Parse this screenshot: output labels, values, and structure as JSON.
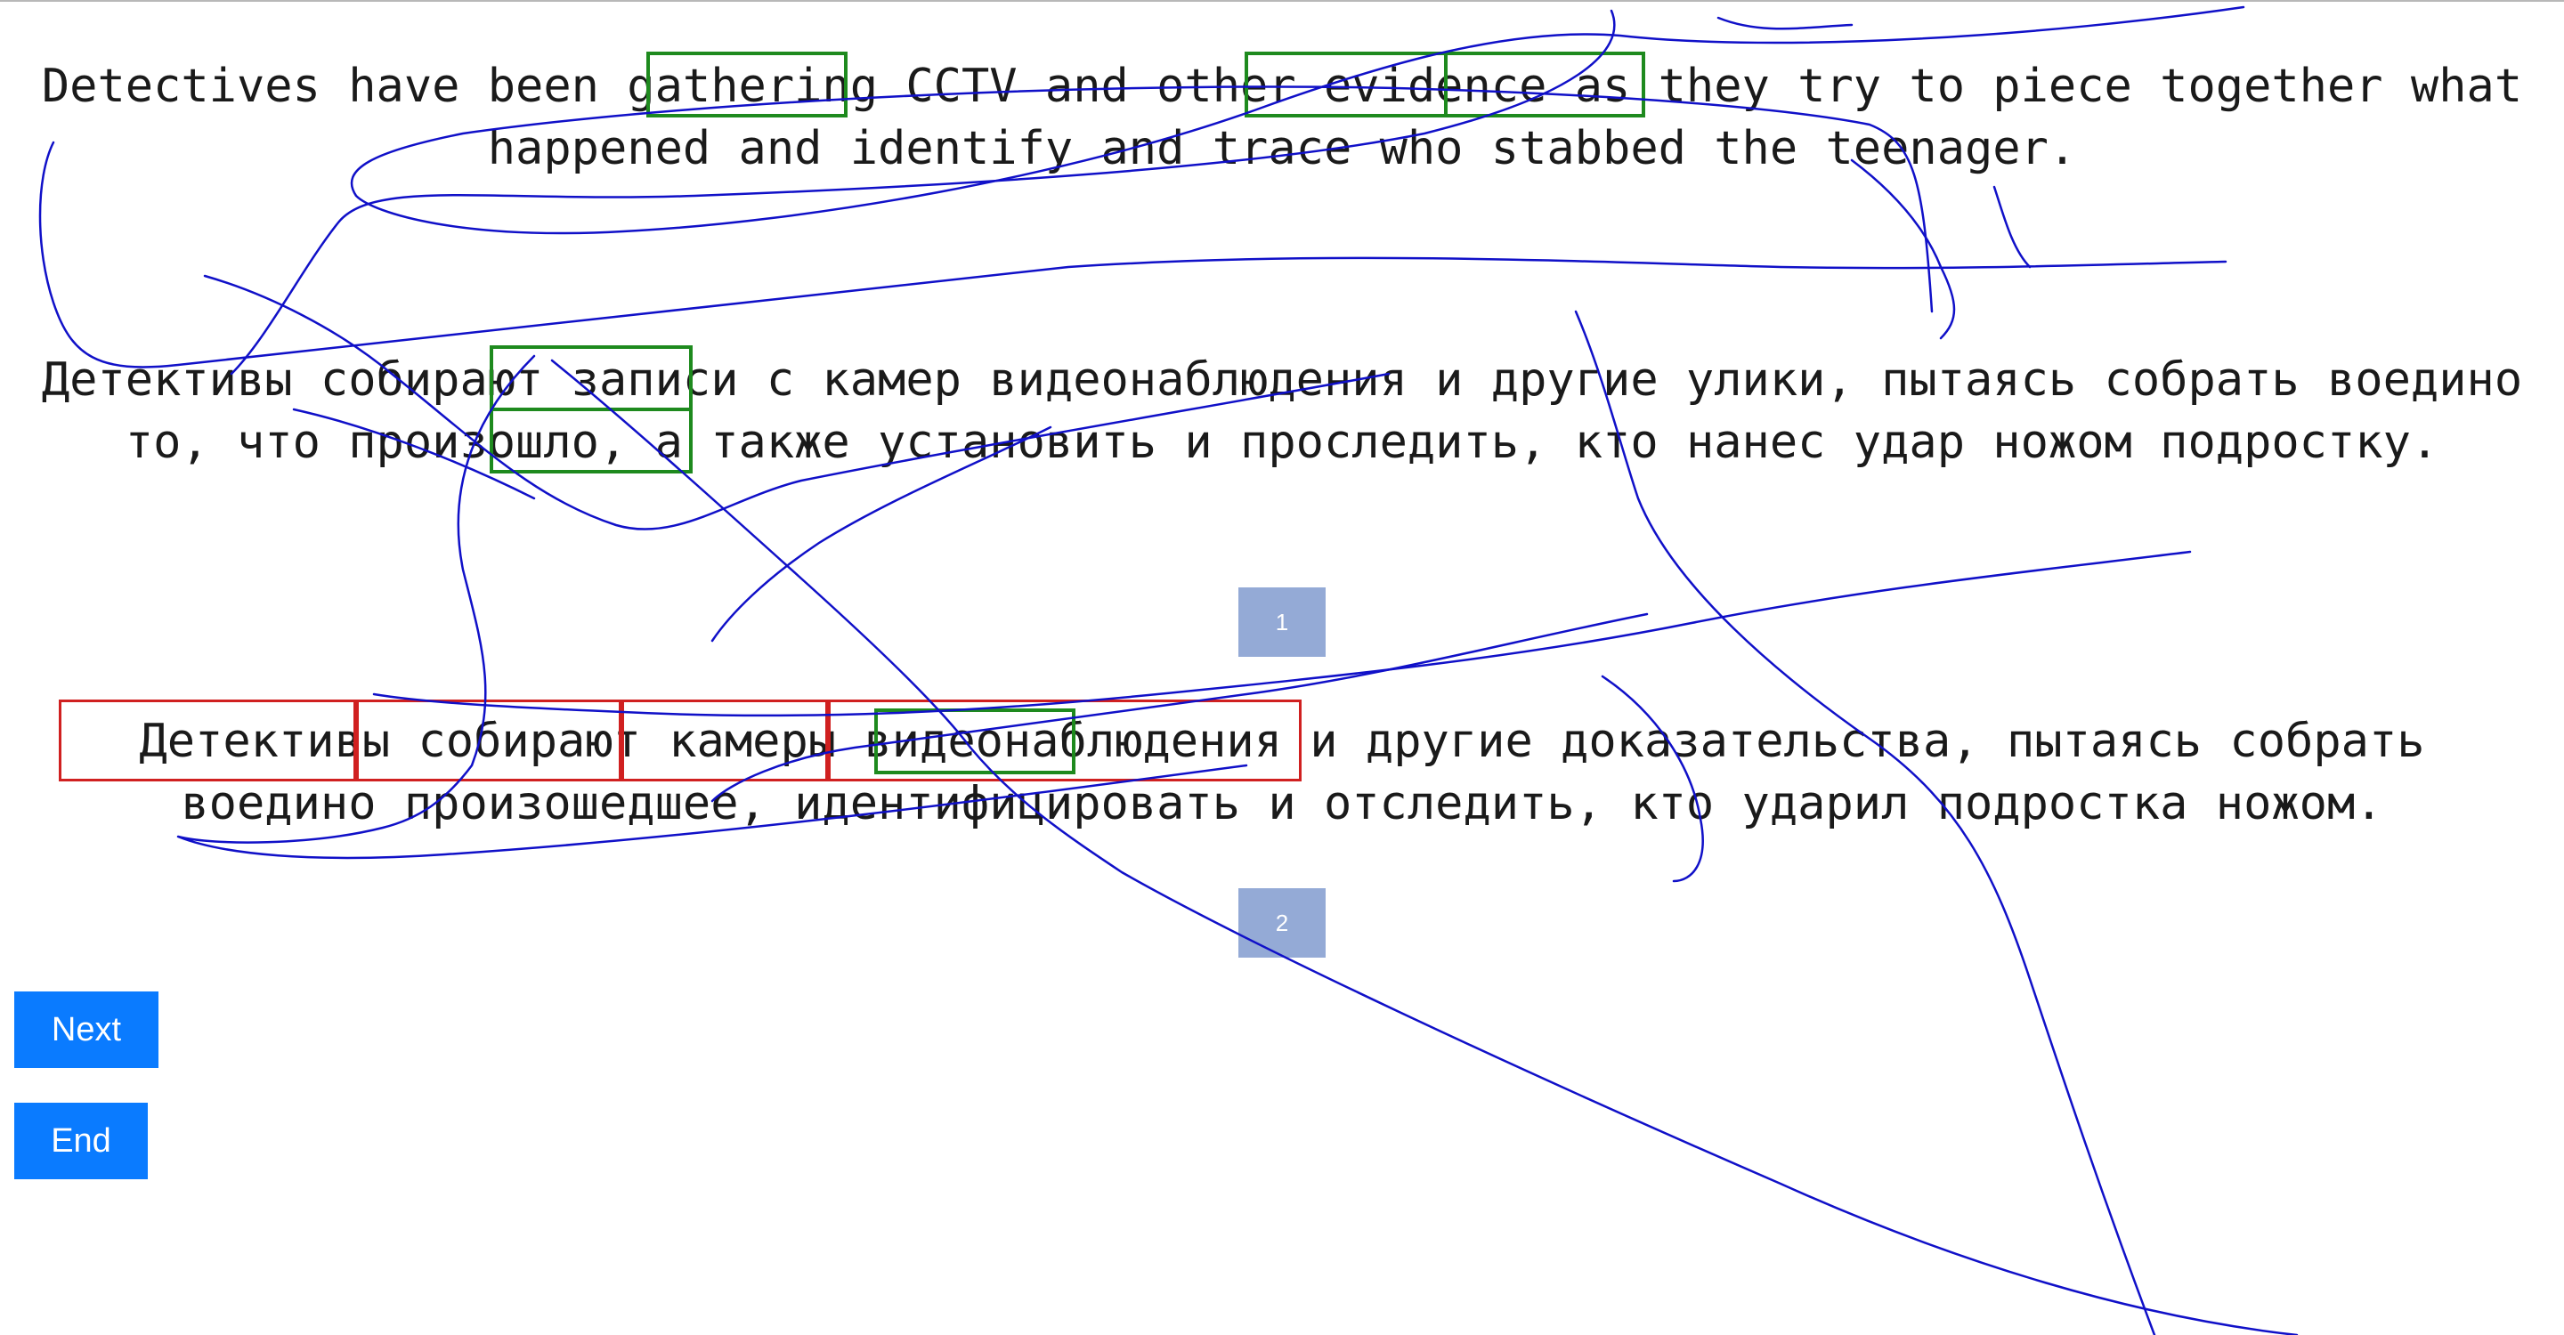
{
  "source_sentence": "Detectives have been gathering CCTV and other evidence as they try to piece together what happened and identify and trace who stabbed the teenager.",
  "reference_translation": "Детективы собирают записи с камер видеонаблюдения и другие улики, пытаясь собрать воедино то, что произошло, а также установить и проследить, кто нанес удар ножом подростку.",
  "candidate_translation": "Детективы собирают камеры видеонаблюдения и другие доказательства, пытаясь собрать воедино произошедшее, идентифицировать и отследить, кто ударил подростка ножом.",
  "badges": {
    "first": "1",
    "second": "2"
  },
  "buttons": {
    "next_label": "Next",
    "end_label": "End"
  },
  "colors": {
    "highlight_green": "#1e8a1e",
    "highlight_red": "#d02020",
    "gaze_trace": "#1010c8",
    "badge": "#94aad6",
    "button": "#0a7bff"
  }
}
